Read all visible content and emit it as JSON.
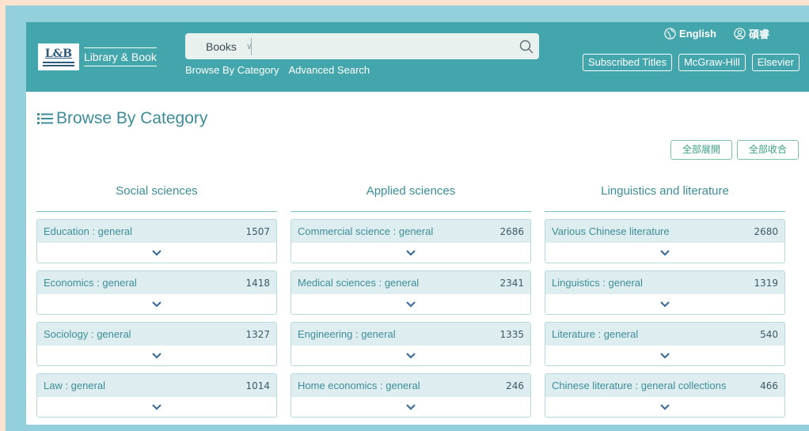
{
  "brand": {
    "badge": "L&B",
    "name": "Library & Book"
  },
  "search": {
    "scope": "Books",
    "placeholder": ""
  },
  "nav": {
    "browse": "Browse By Category",
    "advanced": "Advanced Search"
  },
  "top": {
    "language": "English",
    "user": "碩睿"
  },
  "publishers": [
    "Subscribed Titles",
    "McGraw-Hill",
    "Elsevier"
  ],
  "page_title": "Browse By Category",
  "expand_all": "全部展開",
  "collapse_all": "全部收合",
  "columns": [
    {
      "title": "Social sciences",
      "items": [
        {
          "name": "Education : general",
          "count": "1507"
        },
        {
          "name": "Economics : general",
          "count": "1418"
        },
        {
          "name": "Sociology : general",
          "count": "1327"
        },
        {
          "name": "Law : general",
          "count": "1014"
        }
      ]
    },
    {
      "title": "Applied sciences",
      "items": [
        {
          "name": "Commercial science : general",
          "count": "2686"
        },
        {
          "name": "Medical sciences : general",
          "count": "2341"
        },
        {
          "name": "Engineering : general",
          "count": "1335"
        },
        {
          "name": "Home economics : general",
          "count": "246"
        }
      ]
    },
    {
      "title": "Linguistics and literature",
      "items": [
        {
          "name": "Various Chinese literature",
          "count": "2680"
        },
        {
          "name": "Linguistics : general",
          "count": "1319"
        },
        {
          "name": "Literature : general",
          "count": "540"
        },
        {
          "name": "Chinese literature : general collections",
          "count": "466"
        }
      ]
    }
  ]
}
